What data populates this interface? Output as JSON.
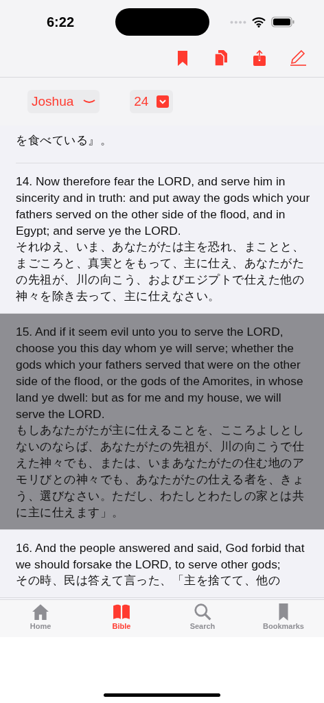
{
  "status_bar": {
    "time": "6:22"
  },
  "toolbar": {
    "actions": [
      {
        "kind": "bookmark"
      },
      {
        "kind": "copy"
      },
      {
        "kind": "share"
      },
      {
        "kind": "edit"
      }
    ]
  },
  "pickers": [
    {
      "kind": "book",
      "value": "Joshua"
    },
    {
      "kind": "chapter",
      "value": "24"
    }
  ],
  "verses": [
    {
      "kind": "partial",
      "japanese": "を食べている』。",
      "selected": false
    },
    {
      "kind": "verse",
      "english": "14. Now therefore fear the LORD, and serve him in sincerity and in truth: and put away the gods which your fathers served on the other side of the flood, and in Egypt; and serve ye the LORD.",
      "japanese": "それゆえ、いま、あなたがたは主を恐れ、まことと、まごころと、真実とをもって、主に仕え、あなたがたの先祖が、川の向こう、およびエジプトで仕えた他の神々を除き去って、主に仕えなさい。",
      "selected": false
    },
    {
      "kind": "verse",
      "english": "15. And if it seem evil unto you to serve the LORD, choose you this day whom ye will serve; whether the gods which your fathers served that were on the other side of the flood, or the gods of the Amorites, in whose land ye dwell: but as for me and my house, we will serve the LORD.",
      "japanese": "もしあなたがたが主に仕えることを、こころよしとしないのならば、あなたがたの先祖が、川の向こうで仕えた神々でも、または、いまあなたがたの住む地のアモリびとの神々でも、あなたがたの仕える者を、きょう、選びなさい。ただし、わたしとわたしの家とは共に主に仕えます」。",
      "selected": true
    },
    {
      "kind": "verse",
      "english": "16. And the people answered and said, God forbid that we should forsake the LORD, to serve other gods;",
      "japanese": "その時、民は答えて言った、「主を捨てて、他の",
      "selected": false
    }
  ],
  "tab_bar": [
    {
      "kind": "home",
      "label": "Home",
      "selected": false
    },
    {
      "kind": "bible",
      "label": "Bible",
      "selected": true
    },
    {
      "kind": "search",
      "label": "Search",
      "selected": false
    },
    {
      "kind": "bookmarks",
      "label": "Bookmarks",
      "selected": false
    }
  ]
}
